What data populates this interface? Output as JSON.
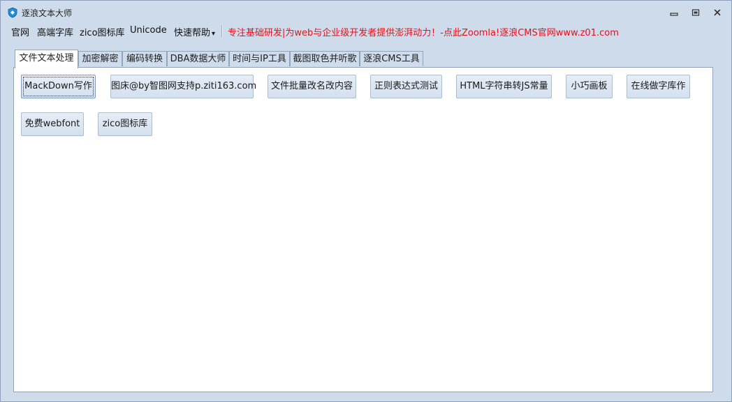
{
  "window": {
    "title": "逐浪文本大师"
  },
  "menubar": {
    "items": [
      "官网",
      "高端字库",
      "zico图标库",
      "Unicode",
      "快速帮助"
    ],
    "dropdown_marker": "▾",
    "promo_text": "专注基础研发|为web与企业级开发者提供澎湃动力！-点此Zoomla!逐浪CMS官网www.z01.com",
    "promo_color": "#e8111b"
  },
  "tabs": [
    "文件文本处理",
    "加密解密",
    "编码转换",
    "DBA数据大师",
    "时间与IP工具",
    "截图取色并听歌",
    "逐浪CMS工具"
  ],
  "active_tab": "文件文本处理",
  "tools": [
    "MackDown写作",
    "图床@by智图网支持p.ziti163.com",
    "文件批量改名改内容",
    "正则表达式测试",
    "HTML字符串转JS常量",
    "小巧画板",
    "在线做字库作",
    "免费webfont",
    "zico图标库"
  ],
  "icons": {
    "app": "shield-icon",
    "minimize": "minimize-icon",
    "restore": "restore-icon",
    "close": "close-icon"
  },
  "colors": {
    "chrome": "#cddbea",
    "panel": "#ffffff",
    "accent_icon": "#1e8fd6"
  }
}
